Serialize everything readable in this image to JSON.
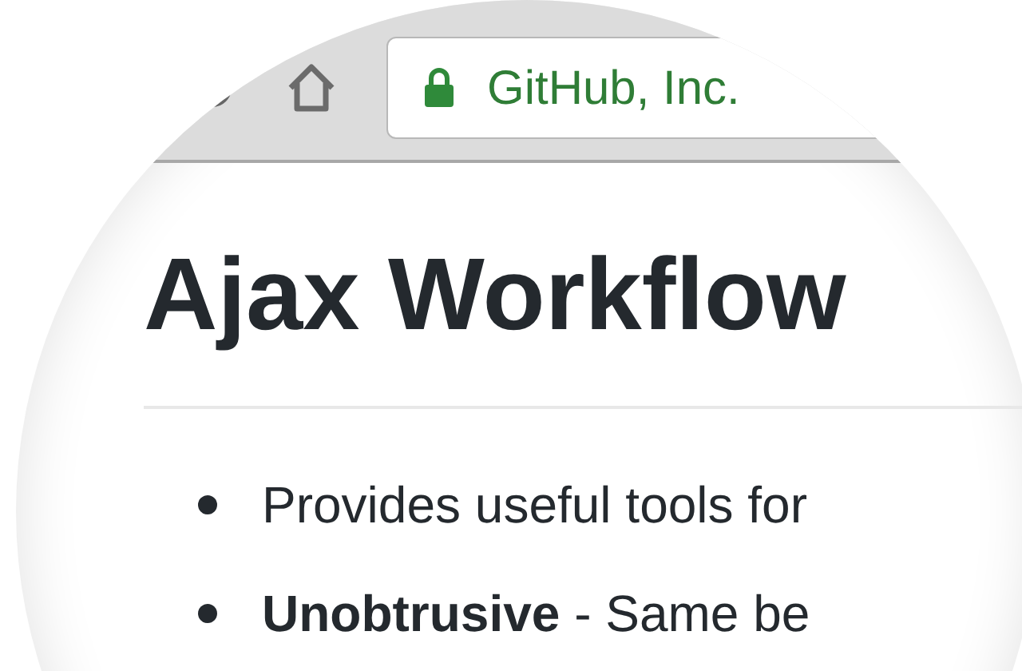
{
  "address_bar": {
    "site_label": "GitHub, Inc."
  },
  "page": {
    "heading": "Ajax Workflow",
    "bullets": [
      {
        "text": "Provides useful tools for"
      },
      {
        "bold": "Unobtrusive",
        "text": " - Same be"
      }
    ]
  }
}
